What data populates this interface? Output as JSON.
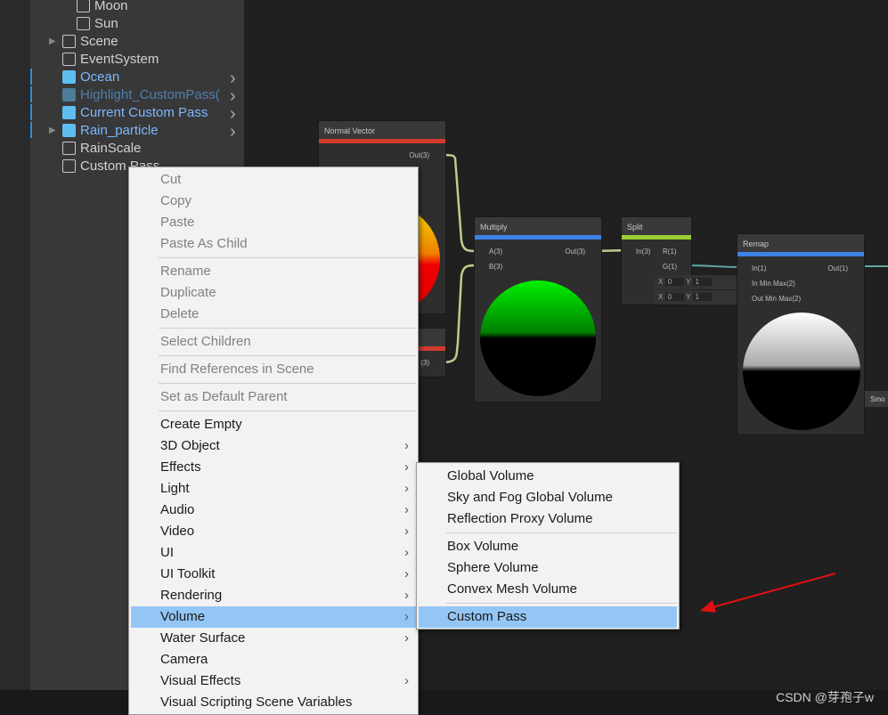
{
  "hierarchy": {
    "items": [
      {
        "label": "Moon",
        "style": "normal",
        "indent": 2
      },
      {
        "label": "Sun",
        "style": "normal",
        "indent": 2
      },
      {
        "label": "Scene",
        "style": "normal",
        "indent": 1,
        "expander": true
      },
      {
        "label": "EventSystem",
        "style": "normal",
        "indent": 1
      },
      {
        "label": "Ocean",
        "style": "blue",
        "indent": 1,
        "chevron": true
      },
      {
        "label": "Highlight_CustomPass(",
        "style": "dim",
        "indent": 1,
        "chevron": true
      },
      {
        "label": "Current Custom Pass",
        "style": "blue",
        "indent": 1,
        "chevron": true
      },
      {
        "label": "Rain_particle",
        "style": "blue",
        "indent": 1,
        "chevron": true,
        "expander": true
      },
      {
        "label": "RainScale",
        "style": "normal",
        "indent": 1
      },
      {
        "label": "Custom Pass",
        "style": "normal",
        "indent": 1
      }
    ]
  },
  "graph": {
    "normal_vector": {
      "title": "Normal Vector",
      "out": "Out(3)",
      "accent": "#d23a2e"
    },
    "node2": {
      "out": "(3)",
      "accent": "#d23a2e"
    },
    "multiply": {
      "title": "Multiply",
      "a": "A(3)",
      "b": "B(3)",
      "out": "Out(3)",
      "accent": "#3d82e6"
    },
    "split": {
      "title": "Split",
      "in": "In(3)",
      "r": "R(1)",
      "g": "G(1)",
      "accent": "#9acd32"
    },
    "remap": {
      "title": "Remap",
      "in": "In(1)",
      "in_min_max": "In Min Max(2)",
      "out_min_max": "Out Min Max(2)",
      "out": "Out(1)",
      "accent": "#3d82e6",
      "x1": "X",
      "v1x": "0",
      "y1": "Y",
      "v1y": "1",
      "x2": "X",
      "v2x": "0",
      "y2": "Y",
      "v2y": "1"
    },
    "smooth_label": "Smo"
  },
  "context_menu": {
    "items": [
      {
        "label": "Cut",
        "disabled": true
      },
      {
        "label": "Copy",
        "disabled": true
      },
      {
        "label": "Paste",
        "disabled": true
      },
      {
        "label": "Paste As Child",
        "disabled": true
      },
      {
        "sep": true
      },
      {
        "label": "Rename",
        "disabled": true
      },
      {
        "label": "Duplicate",
        "disabled": true
      },
      {
        "label": "Delete",
        "disabled": true
      },
      {
        "sep": true
      },
      {
        "label": "Select Children",
        "disabled": true
      },
      {
        "sep": true
      },
      {
        "label": "Find References in Scene",
        "disabled": true
      },
      {
        "sep": true
      },
      {
        "label": "Set as Default Parent",
        "disabled": true
      },
      {
        "sep": true
      },
      {
        "label": "Create Empty"
      },
      {
        "label": "3D Object",
        "submenu": true
      },
      {
        "label": "Effects",
        "submenu": true
      },
      {
        "label": "Light",
        "submenu": true
      },
      {
        "label": "Audio",
        "submenu": true
      },
      {
        "label": "Video",
        "submenu": true
      },
      {
        "label": "UI",
        "submenu": true
      },
      {
        "label": "UI Toolkit",
        "submenu": true
      },
      {
        "label": "Rendering",
        "submenu": true
      },
      {
        "label": "Volume",
        "submenu": true,
        "selected": true
      },
      {
        "label": "Water Surface",
        "submenu": true
      },
      {
        "label": "Camera"
      },
      {
        "label": "Visual Effects",
        "submenu": true
      },
      {
        "label": "Visual Scripting Scene Variables"
      }
    ]
  },
  "volume_submenu": {
    "items": [
      {
        "label": "Global Volume"
      },
      {
        "label": "Sky and Fog Global Volume"
      },
      {
        "label": "Reflection Proxy Volume"
      },
      {
        "sep": true
      },
      {
        "label": "Box Volume"
      },
      {
        "label": "Sphere Volume"
      },
      {
        "label": "Convex Mesh Volume"
      },
      {
        "sep": true
      },
      {
        "label": "Custom Pass",
        "selected": true
      }
    ]
  },
  "annotation": {
    "arrow_color": "#e01010"
  },
  "watermark": "CSDN @芽孢子w"
}
